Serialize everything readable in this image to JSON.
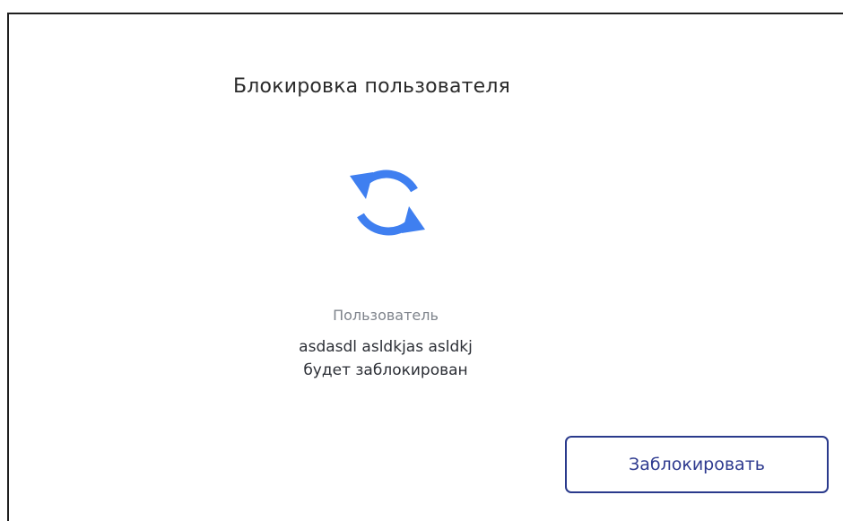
{
  "dialog": {
    "title": "Блокировка пользователя",
    "icon": "refresh-icon",
    "accent_color": "#3f7ff0",
    "caption": "Пользователь",
    "user_name": "asdasdl asldkjas asldkj",
    "status_text": "будет заблокирован",
    "action_button_label": "Заблокировать",
    "button_color": "#2a3a8c"
  }
}
